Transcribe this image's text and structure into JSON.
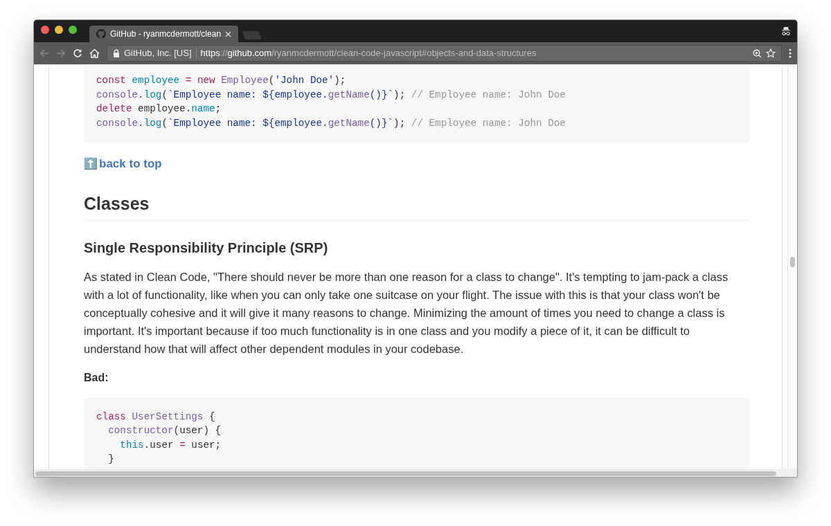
{
  "browser": {
    "tab": {
      "title": "GitHub - ryanmcdermott/clean",
      "selected": true
    },
    "security_label": "GitHub, Inc. [US]",
    "url": [
      {
        "text": "https",
        "bright": true
      },
      {
        "text": "://",
        "bright": false
      },
      {
        "text": "github.com",
        "bright": true
      },
      {
        "text": "/ryanmcdermott/clean-code-javascript#objects-and-data-structures",
        "bright": false
      }
    ]
  },
  "code_top": [
    [
      {
        "kind": "keyword",
        "text": "const"
      },
      {
        "kind": "constant",
        "text": " employee"
      },
      {
        "kind": "keyword",
        "text": " ="
      },
      {
        "kind": "keyword",
        "text": " new"
      },
      {
        "kind": "entity",
        "text": " Employee"
      },
      {
        "kind": "plain",
        "text": "("
      },
      {
        "kind": "string",
        "text": "'John Doe'"
      },
      {
        "kind": "plain",
        "text": ");"
      }
    ],
    [
      {
        "kind": "entity",
        "text": "console"
      },
      {
        "kind": "plain",
        "text": "."
      },
      {
        "kind": "constant",
        "text": "log"
      },
      {
        "kind": "plain",
        "text": "("
      },
      {
        "kind": "string",
        "text": "`Employee name: ${employee."
      },
      {
        "kind": "entity",
        "text": "getName"
      },
      {
        "kind": "string",
        "text": "()}`"
      },
      {
        "kind": "plain",
        "text": "); "
      },
      {
        "kind": "comment",
        "text": "// Employee name: John Doe"
      }
    ],
    [
      {
        "kind": "keyword",
        "text": "delete"
      },
      {
        "kind": "plain",
        "text": " employee."
      },
      {
        "kind": "constant",
        "text": "name"
      },
      {
        "kind": "plain",
        "text": ";"
      }
    ],
    [
      {
        "kind": "entity",
        "text": "console"
      },
      {
        "kind": "plain",
        "text": "."
      },
      {
        "kind": "constant",
        "text": "log"
      },
      {
        "kind": "plain",
        "text": "("
      },
      {
        "kind": "string",
        "text": "`Employee name: ${employee."
      },
      {
        "kind": "entity",
        "text": "getName"
      },
      {
        "kind": "string",
        "text": "()}`"
      },
      {
        "kind": "plain",
        "text": "); "
      },
      {
        "kind": "comment",
        "text": "// Employee name: John Doe"
      }
    ]
  ],
  "back_to_top": {
    "icon": "⬆️",
    "label": "back to top"
  },
  "heading": "Classes",
  "subheading": "Single Responsibility Principle (SRP)",
  "paragraph": "As stated in Clean Code, \"There should never be more than one reason for a class to change\". It's tempting to jam-pack a class with a lot of functionality, like when you can only take one suitcase on your flight. The issue with this is that your class won't be conceptually cohesive and it will give it many reasons to change. Minimizing the amount of times you need to change a class is important. It's important because if too much functionality is in one class and you modify a piece of it, it can be difficult to understand how that will affect other dependent modules in your codebase.",
  "label": "Bad:",
  "code_bottom": [
    [
      {
        "kind": "keyword",
        "text": "class"
      },
      {
        "kind": "entity",
        "text": " UserSettings"
      },
      {
        "kind": "plain",
        "text": " {"
      }
    ],
    [
      {
        "kind": "entity",
        "text": "  constructor"
      },
      {
        "kind": "plain",
        "text": "(user) {"
      }
    ],
    [
      {
        "kind": "constant",
        "text": "    this"
      },
      {
        "kind": "plain",
        "text": ".user "
      },
      {
        "kind": "keyword",
        "text": "="
      },
      {
        "kind": "plain",
        "text": " user;"
      }
    ],
    [
      {
        "kind": "plain",
        "text": "  }"
      }
    ]
  ]
}
